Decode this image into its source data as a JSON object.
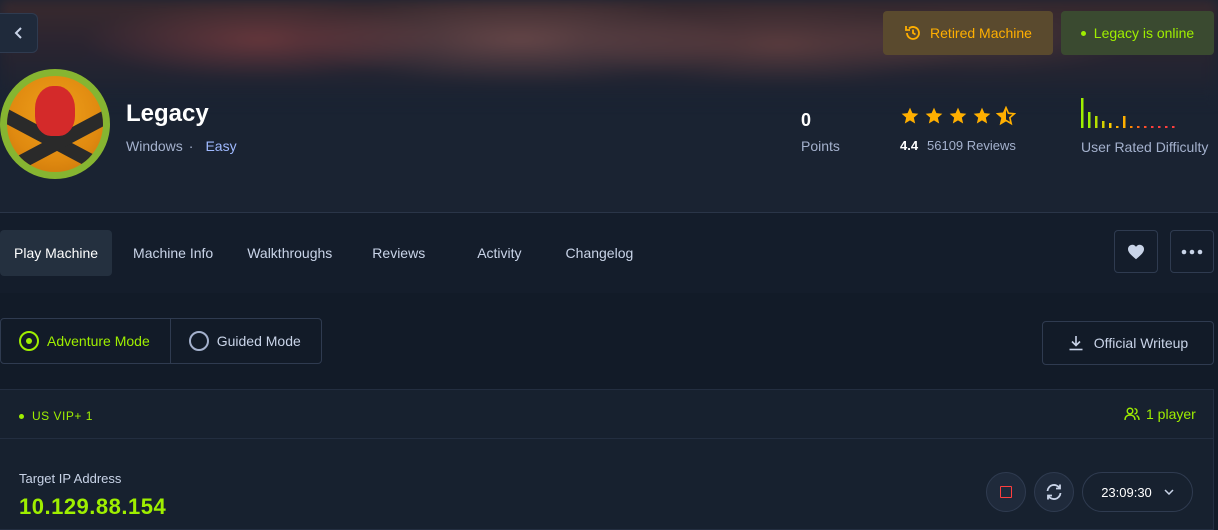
{
  "header": {
    "retired_label": "Retired Machine",
    "online_label": "Legacy is online"
  },
  "machine": {
    "name": "Legacy",
    "os": "Windows",
    "separator": "·",
    "difficulty": "Easy"
  },
  "stats": {
    "points_value": "0",
    "points_label": "Points",
    "rating_value": "4.4",
    "rating_stars": 4.5,
    "reviews_label": "56109 Reviews",
    "difficulty_label": "User Rated Difficulty"
  },
  "tabs": [
    {
      "label": "Play Machine",
      "active": true
    },
    {
      "label": "Machine Info"
    },
    {
      "label": "Walkthroughs"
    },
    {
      "label": "Reviews"
    },
    {
      "label": "Activity"
    },
    {
      "label": "Changelog"
    }
  ],
  "modes": {
    "adventure": "Adventure Mode",
    "guided": "Guided Mode"
  },
  "writeup_label": "Official Writeup",
  "vpn": {
    "server": "US VIP+ 1",
    "players": "1 player",
    "ip_label": "Target IP Address",
    "ip_value": "10.129.88.154",
    "timer": "23:09:30"
  },
  "colors": {
    "accent_green": "#9fef00",
    "accent_orange": "#ffaf00",
    "danger_red": "#ff3e3e",
    "background": "#141d2b"
  }
}
